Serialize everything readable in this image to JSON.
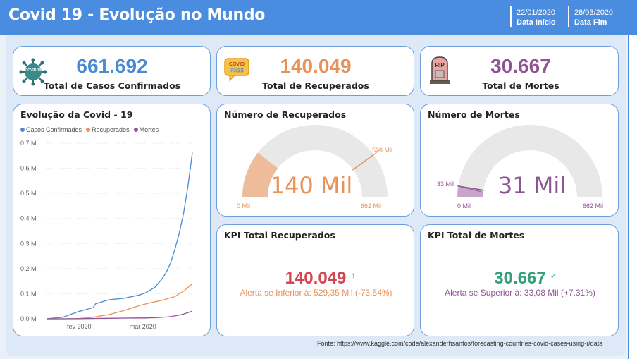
{
  "header": {
    "title": "Covid 19 - Evolução no Mundo",
    "start_date": "22/01/2020",
    "start_label": "Data Início",
    "end_date": "28/03/2020",
    "end_label": "Data Fim"
  },
  "kpis": {
    "confirmed": {
      "value": "661.692",
      "label": "Total de Casos Confirmados",
      "icon": "virus-icon",
      "icon_text": "COVID 19"
    },
    "recovered": {
      "value": "140.049",
      "label": "Total de Recuperados",
      "icon": "covid-free-icon",
      "icon_text": "COVID FREE"
    },
    "deaths": {
      "value": "30.667",
      "label": "Total de Mortes",
      "icon": "tombstone-icon",
      "icon_text": "RIP"
    }
  },
  "colors": {
    "confirmed": "#4a8ad0",
    "recovered": "#e8925a",
    "deaths": "#8e5594",
    "header": "#4a8de0",
    "kpi_recovered_value": "#d64550",
    "kpi_deaths_value": "#34a07a",
    "gauge_bg": "#e8e8e8",
    "gauge_rec_fill": "#efbc9b",
    "gauge_death_fill": "#c8a6cc"
  },
  "line_card": {
    "title": "Evolução da Covid - 19",
    "legend": [
      "Casos Confirmados",
      "Recuperados",
      "Mortes"
    ]
  },
  "chart_data": {
    "type": "line",
    "title": "Evolução da Covid - 19",
    "x_ticks": [
      "fev 2020",
      "mar 2020"
    ],
    "y_ticks": [
      "0,0 Mi",
      "0,1 Mi",
      "0,2 Mi",
      "0,3 Mi",
      "0,4 Mi",
      "0,5 Mi",
      "0,6 Mi",
      "0,7 Mi"
    ],
    "ylim": [
      0,
      0.7
    ],
    "y_unit": "Mi",
    "x": [
      "2020-01-22",
      "2020-01-29",
      "2020-02-05",
      "2020-02-12",
      "2020-02-13",
      "2020-02-19",
      "2020-02-26",
      "2020-03-04",
      "2020-03-07",
      "2020-03-11",
      "2020-03-14",
      "2020-03-16",
      "2020-03-18",
      "2020-03-20",
      "2020-03-22",
      "2020-03-24",
      "2020-03-26",
      "2020-03-28"
    ],
    "series": [
      {
        "name": "Casos Confirmados",
        "values": [
          0.0006,
          0.006,
          0.028,
          0.045,
          0.06,
          0.076,
          0.082,
          0.095,
          0.105,
          0.126,
          0.157,
          0.183,
          0.22,
          0.275,
          0.34,
          0.42,
          0.53,
          0.662
        ]
      },
      {
        "name": "Recuperados",
        "values": [
          0.0,
          0.0001,
          0.001,
          0.006,
          0.008,
          0.017,
          0.033,
          0.053,
          0.06,
          0.068,
          0.073,
          0.078,
          0.084,
          0.088,
          0.1,
          0.11,
          0.125,
          0.14
        ]
      },
      {
        "name": "Mortes",
        "values": [
          0.0,
          0.0001,
          0.0005,
          0.0012,
          0.0014,
          0.002,
          0.0028,
          0.0033,
          0.0035,
          0.0044,
          0.0058,
          0.0071,
          0.0088,
          0.0115,
          0.0145,
          0.019,
          0.0245,
          0.0307
        ]
      }
    ]
  },
  "gauge_recovered": {
    "title": "Número de Recuperados",
    "value": 140049,
    "min": 0,
    "max": 661692,
    "target": 529000,
    "center_text": "140 Mil",
    "min_label": "0 Mil",
    "max_label": "662 Mil",
    "target_label": "529 Mil"
  },
  "gauge_deaths": {
    "title": "Número de Mortes",
    "value": 30667,
    "min": 0,
    "max": 661692,
    "target": 33000,
    "center_text": "31 Mil",
    "min_label": "0 Mil",
    "max_label": "662 Mil",
    "target_label": "33 Mil"
  },
  "kpi_recovered": {
    "title": "KPI Total Recuperados",
    "value": "140.049",
    "indicator": "!",
    "alert_text": "Alerta se Inferior à: 529,35 Mil (-73.54%)"
  },
  "kpi_deaths": {
    "title": "KPI Total de Mortes",
    "value": "30.667",
    "indicator": "✓",
    "alert_text": "Alerta se Superior à: 33,08 Mil (+7.31%)"
  },
  "footer": {
    "source": "Fonte: https://www.kaggle.com/code/alexanderhsantos/forecasting-countries-covid-cases-using-r/data"
  }
}
